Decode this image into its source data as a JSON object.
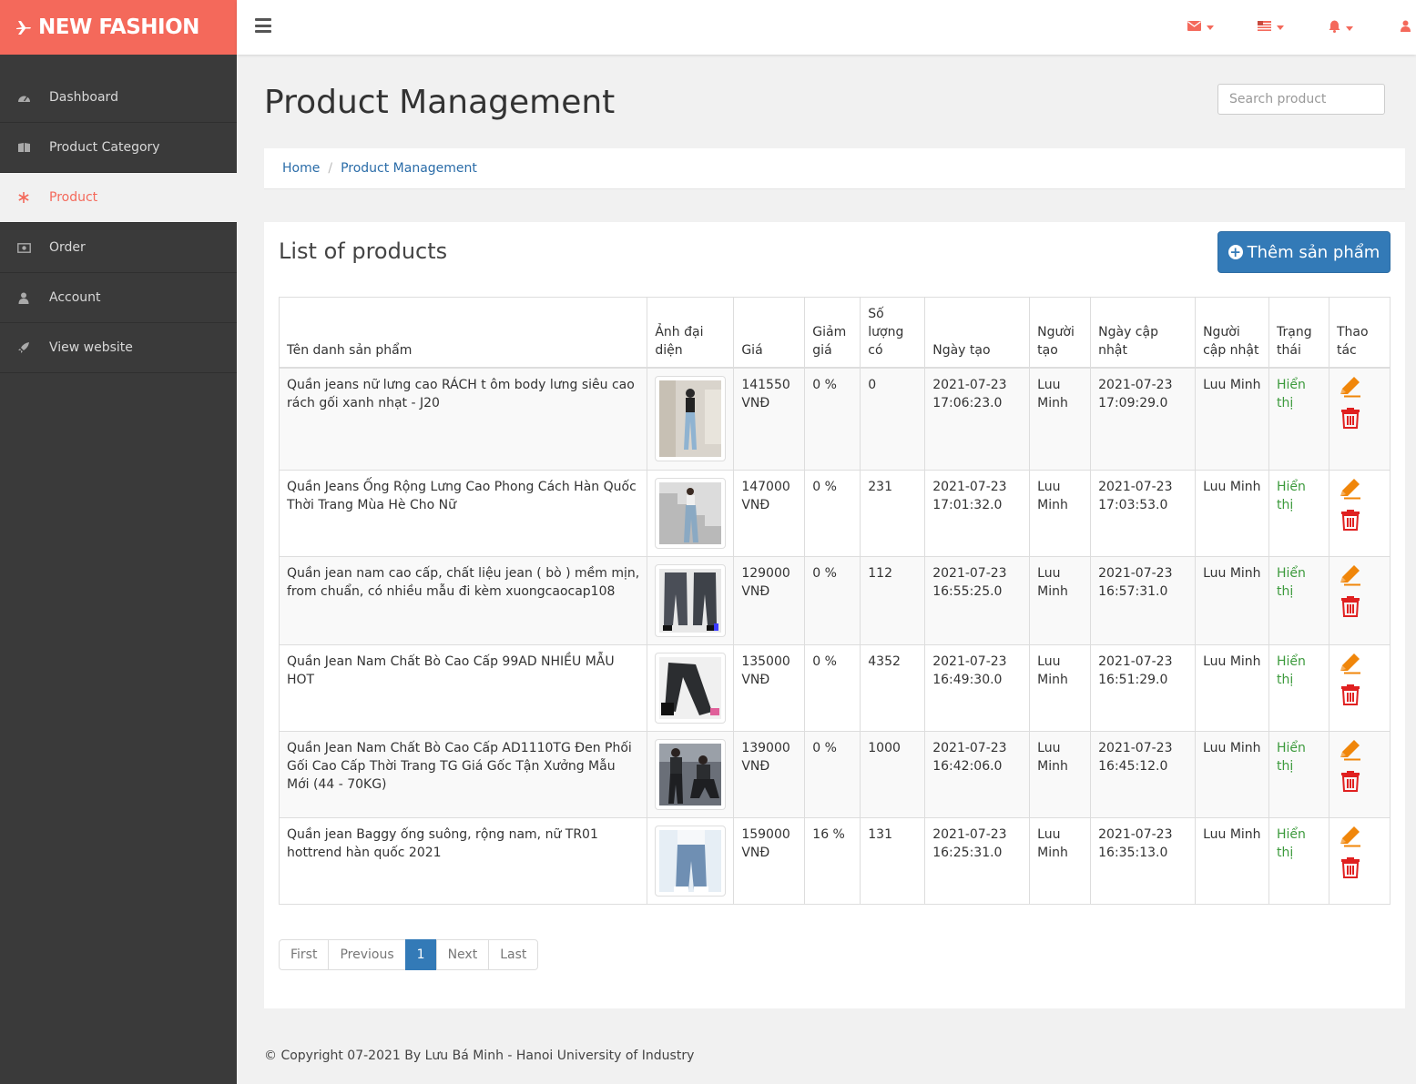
{
  "brand": {
    "name": "NEW FASHION"
  },
  "colors": {
    "accent": "#f4695b",
    "primary": "#337ab7",
    "sidebar_bg": "#3a3a3a",
    "status_green": "#3c9a3c",
    "edit_orange": "#f0860a",
    "delete_red": "#e02020"
  },
  "sidebar": {
    "items": [
      {
        "label": "Dashboard",
        "icon": "dashboard-icon"
      },
      {
        "label": "Product Category",
        "icon": "book-icon"
      },
      {
        "label": "Product",
        "icon": "snowflake-icon",
        "active": true
      },
      {
        "label": "Order",
        "icon": "money-icon"
      },
      {
        "label": "Account",
        "icon": "user-icon"
      },
      {
        "label": "View website",
        "icon": "rocket-icon"
      }
    ]
  },
  "topbar": {
    "icons": [
      "envelope-icon",
      "flag-icon",
      "bell-icon",
      "user-icon"
    ]
  },
  "page": {
    "title": "Product Management"
  },
  "search": {
    "placeholder": "Search product"
  },
  "breadcrumb": {
    "home": "Home",
    "current": "Product Management"
  },
  "panel": {
    "title": "List of products",
    "add_button": "Thêm sản phẩm"
  },
  "table": {
    "headers": {
      "name": "Tên danh sản phẩm",
      "image": "Ảnh đại diện",
      "price": "Giá",
      "discount": "Giảm giá",
      "quantity": "Số lượng có",
      "created": "Ngày tạo",
      "creator": "Người tạo",
      "updated": "Ngày cập nhật",
      "updater": "Người cập nhật",
      "status": "Trạng thái",
      "actions": "Thao tác"
    },
    "rows": [
      {
        "name": "Quần jeans nữ lưng cao RÁCH t ôm body lưng siêu cao rách gối xanh nhạt - J20",
        "price": "141550",
        "currency": "VNĐ",
        "discount": "0 %",
        "quantity": "0",
        "created_date": "2021-07-23",
        "created_time": "17:06:23.0",
        "creator_first": "Luu",
        "creator_last": "Minh",
        "updated_date": "2021-07-23",
        "updated_time": "17:09:29.0",
        "updater": "Luu Minh",
        "status_1": "Hiển",
        "status_2": "thị"
      },
      {
        "name": "Quần Jeans Ống Rộng Lưng Cao Phong Cách Hàn Quốc Thời Trang Mùa Hè Cho Nữ",
        "price": "147000",
        "currency": "VNĐ",
        "discount": "0 %",
        "quantity": "231",
        "created_date": "2021-07-23",
        "created_time": "17:01:32.0",
        "creator_first": "Luu",
        "creator_last": "Minh",
        "updated_date": "2021-07-23",
        "updated_time": "17:03:53.0",
        "updater": "Luu Minh",
        "status_1": "Hiển",
        "status_2": "thị"
      },
      {
        "name": "Quần jean nam cao cấp, chất liệu jean ( bò ) mềm mịn, from chuẩn, có nhiều mẫu đi kèm xuongcaocap108",
        "price": "129000",
        "currency": "VNĐ",
        "discount": "0 %",
        "quantity": "112",
        "created_date": "2021-07-23",
        "created_time": "16:55:25.0",
        "creator_first": "Luu",
        "creator_last": "Minh",
        "updated_date": "2021-07-23",
        "updated_time": "16:57:31.0",
        "updater": "Luu Minh",
        "status_1": "Hiển",
        "status_2": "thị"
      },
      {
        "name": "Quần Jean Nam Chất Bò Cao Cấp 99AD NHIỀU MẪU HOT",
        "price": "135000",
        "currency": "VNĐ",
        "discount": "0 %",
        "quantity": "4352",
        "created_date": "2021-07-23",
        "created_time": "16:49:30.0",
        "creator_first": "Luu",
        "creator_last": "Minh",
        "updated_date": "2021-07-23",
        "updated_time": "16:51:29.0",
        "updater": "Luu Minh",
        "status_1": "Hiển",
        "status_2": "thị"
      },
      {
        "name": "Quần Jean Nam Chất Bò Cao Cấp AD1110TG Đen Phối Gối Cao Cấp Thời Trang TG Giá Gốc Tận Xưởng Mẫu Mới (44 - 70KG)",
        "price": "139000",
        "currency": "VNĐ",
        "discount": "0 %",
        "quantity": "1000",
        "created_date": "2021-07-23",
        "created_time": "16:42:06.0",
        "creator_first": "Luu",
        "creator_last": "Minh",
        "updated_date": "2021-07-23",
        "updated_time": "16:45:12.0",
        "updater": "Luu Minh",
        "status_1": "Hiển",
        "status_2": "thị"
      },
      {
        "name": "Quần jean Baggy ống suông, rộng nam, nữ TR01 hottrend hàn quốc 2021",
        "price": "159000",
        "currency": "VNĐ",
        "discount": "16 %",
        "quantity": "131",
        "created_date": "2021-07-23",
        "created_time": "16:25:31.0",
        "creator_first": "Luu",
        "creator_last": "Minh",
        "updated_date": "2021-07-23",
        "updated_time": "16:35:13.0",
        "updater": "Luu Minh",
        "status_1": "Hiển",
        "status_2": "thị"
      }
    ]
  },
  "pagination": {
    "first": "First",
    "previous": "Previous",
    "current": "1",
    "next": "Next",
    "last": "Last"
  },
  "footer": {
    "text": "© Copyright 07-2021 By Lưu Bá Minh - Hanoi University of Industry"
  }
}
